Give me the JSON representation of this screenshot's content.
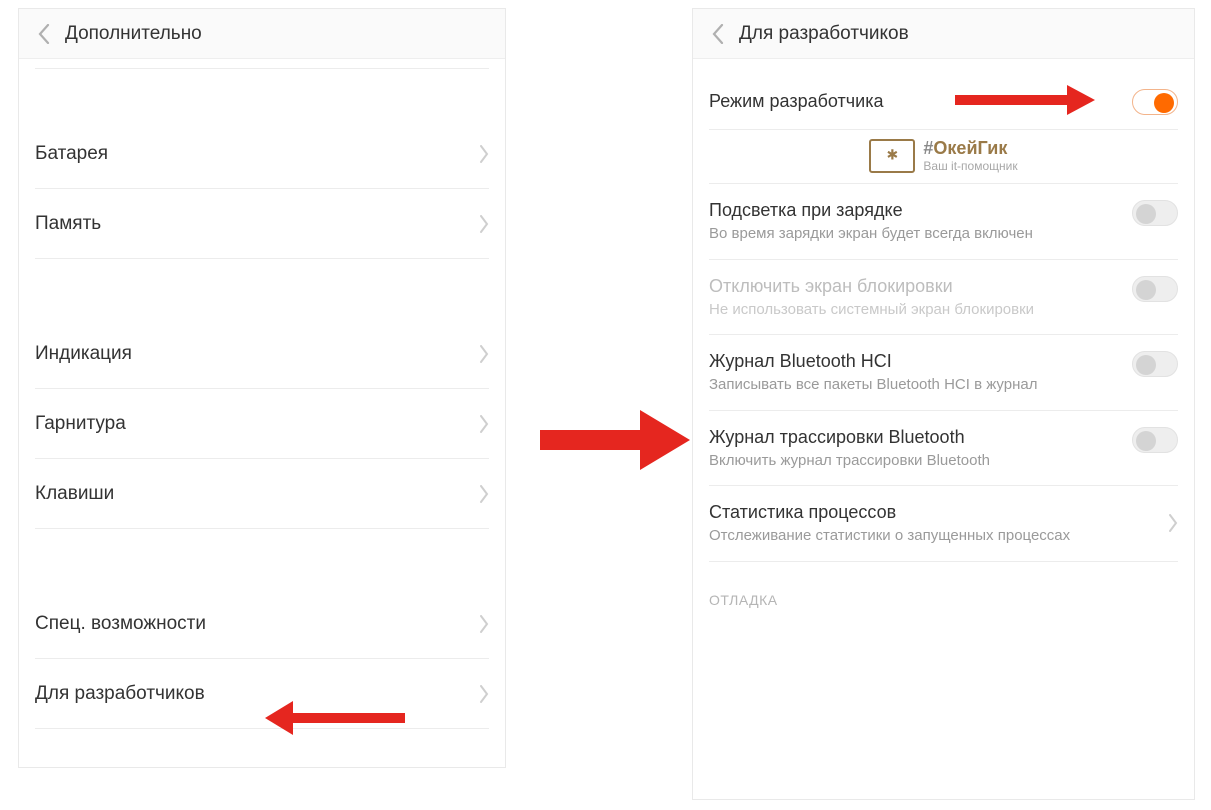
{
  "left": {
    "title": "Дополнительно",
    "items": {
      "battery": "Батарея",
      "memory": "Память",
      "indication": "Индикация",
      "headset": "Гарнитура",
      "keys": "Клавиши",
      "accessibility": "Спец. возможности",
      "developer": "Для разработчиков"
    }
  },
  "right": {
    "title": "Для разработчиков",
    "dev_mode": {
      "title": "Режим разработчика"
    },
    "backlight": {
      "title": "Подсветка при зарядке",
      "sub": "Во время зарядки экран будет всегда включен"
    },
    "nolock": {
      "title": "Отключить экран блокировки",
      "sub": "Не использовать системный экран блокировки"
    },
    "bt_hci": {
      "title": "Журнал Bluetooth HCI",
      "sub": "Записывать все пакеты Bluetooth HCI в журнал"
    },
    "bt_trace": {
      "title": "Журнал трассировки Bluetooth",
      "sub": "Включить журнал трассировки Bluetooth"
    },
    "proc_stats": {
      "title": "Статистика процессов",
      "sub": "Отслеживание статистики о запущенных процессах"
    },
    "section_debug": "ОТЛАДКА"
  },
  "watermark": {
    "line1_pre": "#",
    "line1_main": "ОкейГик",
    "line2": "Ваш it-помощник"
  }
}
